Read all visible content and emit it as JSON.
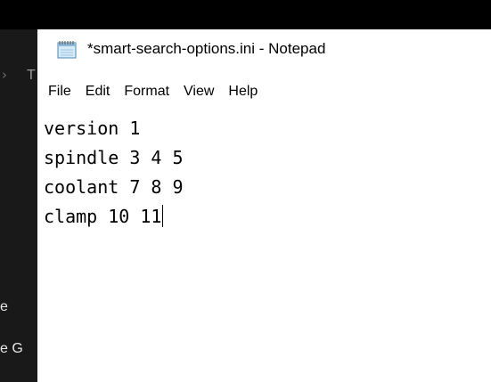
{
  "window": {
    "title": "*smart-search-options.ini - Notepad",
    "icon": "notepad-icon"
  },
  "menu": {
    "items": [
      {
        "label": "File"
      },
      {
        "label": "Edit"
      },
      {
        "label": "Format"
      },
      {
        "label": "View"
      },
      {
        "label": "Help"
      }
    ]
  },
  "editor": {
    "lines": [
      "version 1",
      "spindle 3 4 5",
      "coolant 7 8 9",
      "clamp 10 11"
    ]
  },
  "background": {
    "left_text_1": "e",
    "left_text_2": "e G",
    "tab_letter": "T",
    "chevron": "›"
  },
  "colors": {
    "dark_background": "#191919",
    "top_bar": "#000000",
    "window_background": "#ffffff"
  }
}
